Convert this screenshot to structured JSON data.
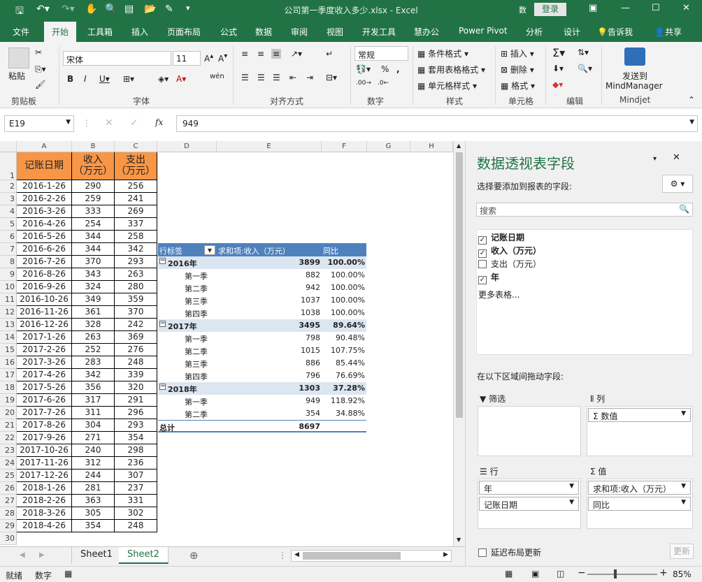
{
  "title": {
    "doc": "公司第一季度收入多少.xlsx  -  Excel",
    "login": "登录",
    "extra": "数"
  },
  "tabs": [
    "文件",
    "开始",
    "工具箱",
    "插入",
    "页面布局",
    "公式",
    "数据",
    "审阅",
    "视图",
    "开发工具",
    "慧办公",
    "Power Pivot",
    "分析",
    "设计",
    "告诉我",
    "共享"
  ],
  "ribbon": {
    "groups": [
      "剪贴板",
      "字体",
      "对齐方式",
      "数字",
      "样式",
      "单元格",
      "编辑",
      "Mindjet"
    ],
    "paste": "粘贴",
    "font": "宋体",
    "size": "11",
    "numfmt": "常规",
    "cond": "条件格式",
    "tablefmt": "套用表格格式",
    "cellstyle": "单元格样式",
    "insert": "插入",
    "delete": "删除",
    "format": "格式",
    "mm1": "发送到",
    "mm2": "MindManager"
  },
  "formula": {
    "cell": "E19",
    "value": "949"
  },
  "columns": [
    "A",
    "B",
    "C",
    "D",
    "E",
    "F",
    "G",
    "H"
  ],
  "headers": [
    "记账日期",
    "收入\n（万元）",
    "支出\n（万元）"
  ],
  "rows": [
    [
      "2016-1-26",
      "290",
      "256"
    ],
    [
      "2016-2-26",
      "259",
      "241"
    ],
    [
      "2016-3-26",
      "333",
      "269"
    ],
    [
      "2016-4-26",
      "254",
      "337"
    ],
    [
      "2016-5-26",
      "344",
      "258"
    ],
    [
      "2016-6-26",
      "344",
      "342"
    ],
    [
      "2016-7-26",
      "370",
      "293"
    ],
    [
      "2016-8-26",
      "343",
      "263"
    ],
    [
      "2016-9-26",
      "324",
      "280"
    ],
    [
      "2016-10-26",
      "349",
      "359"
    ],
    [
      "2016-11-26",
      "361",
      "370"
    ],
    [
      "2016-12-26",
      "328",
      "242"
    ],
    [
      "2017-1-26",
      "263",
      "369"
    ],
    [
      "2017-2-26",
      "252",
      "276"
    ],
    [
      "2017-3-26",
      "283",
      "248"
    ],
    [
      "2017-4-26",
      "342",
      "339"
    ],
    [
      "2017-5-26",
      "356",
      "320"
    ],
    [
      "2017-6-26",
      "317",
      "291"
    ],
    [
      "2017-7-26",
      "311",
      "296"
    ],
    [
      "2017-8-26",
      "304",
      "293"
    ],
    [
      "2017-9-26",
      "271",
      "354"
    ],
    [
      "2017-10-26",
      "240",
      "298"
    ],
    [
      "2017-11-26",
      "312",
      "236"
    ],
    [
      "2017-12-26",
      "244",
      "307"
    ],
    [
      "2018-1-26",
      "281",
      "237"
    ],
    [
      "2018-2-26",
      "363",
      "331"
    ],
    [
      "2018-3-26",
      "305",
      "302"
    ],
    [
      "2018-4-26",
      "354",
      "248"
    ]
  ],
  "pivot": {
    "h1": "行标签",
    "h2": "求和项:收入（万元）",
    "h3": "同比",
    "rows": [
      {
        "label": "2016年",
        "sum": "3899",
        "yoy": "100.00%",
        "type": "year"
      },
      {
        "label": "第一季",
        "sum": "882",
        "yoy": "100.00%",
        "type": "q"
      },
      {
        "label": "第二季",
        "sum": "942",
        "yoy": "100.00%",
        "type": "q"
      },
      {
        "label": "第三季",
        "sum": "1037",
        "yoy": "100.00%",
        "type": "q"
      },
      {
        "label": "第四季",
        "sum": "1038",
        "yoy": "100.00%",
        "type": "q"
      },
      {
        "label": "2017年",
        "sum": "3495",
        "yoy": "89.64%",
        "type": "year"
      },
      {
        "label": "第一季",
        "sum": "798",
        "yoy": "90.48%",
        "type": "q"
      },
      {
        "label": "第二季",
        "sum": "1015",
        "yoy": "107.75%",
        "type": "q"
      },
      {
        "label": "第三季",
        "sum": "886",
        "yoy": "85.44%",
        "type": "q"
      },
      {
        "label": "第四季",
        "sum": "796",
        "yoy": "76.69%",
        "type": "q"
      },
      {
        "label": "2018年",
        "sum": "1303",
        "yoy": "37.28%",
        "type": "year"
      },
      {
        "label": "第一季",
        "sum": "949",
        "yoy": "118.92%",
        "type": "q"
      },
      {
        "label": "第二季",
        "sum": "354",
        "yoy": "34.88%",
        "type": "q"
      }
    ],
    "total_label": "总计",
    "total": "8697"
  },
  "sheets": [
    "Sheet1",
    "Sheet2"
  ],
  "status": {
    "ready": "就绪",
    "mode": "数字",
    "zoom": "85%"
  },
  "panel": {
    "title": "数据透视表字段",
    "subtitle": "选择要添加到报表的字段:",
    "search": "搜索",
    "fields": [
      {
        "name": "记账日期",
        "checked": true
      },
      {
        "name": "收入（万元）",
        "checked": true
      },
      {
        "name": "支出（万元）",
        "checked": false
      },
      {
        "name": "年",
        "checked": true
      }
    ],
    "more": "更多表格...",
    "drag": "在以下区域间拖动字段:",
    "filter": "筛选",
    "cols": "列",
    "rows": "行",
    "values": "值",
    "col_item": "Σ 数值",
    "row_items": [
      "年",
      "记账日期"
    ],
    "val_items": [
      "求和项:收入（万元）",
      "同比"
    ],
    "defer": "延迟布局更新",
    "update": "更新"
  }
}
